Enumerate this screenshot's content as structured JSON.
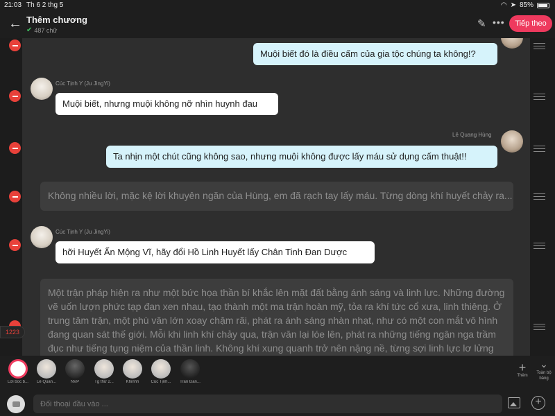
{
  "status": {
    "time": "21:03",
    "date": "Th 6 2 thg 5",
    "battery": "85%"
  },
  "header": {
    "back_icon": "arrow-left-icon",
    "title": "Thêm chương",
    "word_count": "487 chữ",
    "next_label": "Tiếp theo",
    "accent": "#ee3a5e"
  },
  "messages": [
    {
      "speaker": "",
      "side": "right",
      "text": "Muội biết đó là điều cấm của gia tộc chúng ta không!?"
    },
    {
      "speaker": "Cúc Tịnh Y (Ju JingYi)",
      "side": "left",
      "text": "Muội biết, nhưng muội không nỡ nhìn huynh đau"
    },
    {
      "speaker": "Lê Quang Hùng",
      "side": "right",
      "text": "Ta nhịn một chút cũng không sao, nhưng muội không được lấy máu sử dụng cấm thuật!!"
    },
    {
      "speaker": "",
      "side": "narration",
      "text": "Không nhiều lời, mặc kệ lời khuyên ngăn của Hùng, em đã rạch tay lấy máu. Từng dòng khí huyết chảy ra..."
    },
    {
      "speaker": "Cúc Tịnh Y (Ju JingYi)",
      "side": "left",
      "text": "hỡi Huyết Ấn Mộng Vĩ, hãy đổi Hồ Linh Huyết lấy Chân Tinh Đan Dược"
    },
    {
      "speaker": "",
      "side": "narration",
      "text": "Một trận pháp hiện ra như một bức họa thần bí khắc lên mặt đất bằng ánh sáng và linh lực. Những đường vẽ uốn lượn phức tạp đan xen nhau, tạo thành một ma trận hoàn mỹ, tỏa ra khí tức cổ xưa, linh thiêng. Ở trung tâm trận, một phù văn lớn xoay chậm rãi, phát ra ánh sáng nhàn nhạt, như có một con mắt vô hình đang quan sát thế giới. Mỗi khi linh khí chảy qua, trận văn lại lóe lên, phát ra những tiếng ngân nga trầm đục như tiếng tụng niệm của thần linh. Không khí xung quanh trở nên nặng nề, từng sợi linh lực lơ lửng"
    }
  ],
  "counter": "1223",
  "characters": [
    {
      "name": "Lời bốc b..."
    },
    {
      "name": "Lê Quan..."
    },
    {
      "name": "NVP"
    },
    {
      "name": "Tg thứ 2..."
    },
    {
      "name": "Khinhh"
    },
    {
      "name": "Cúc Tịnh..."
    },
    {
      "name": "Trần Đăn..."
    }
  ],
  "toolbar": {
    "add_label": "Thêm",
    "all_label": "Toàn bộ bảng"
  },
  "input": {
    "placeholder": "Đối thoại đầu vào ..."
  }
}
